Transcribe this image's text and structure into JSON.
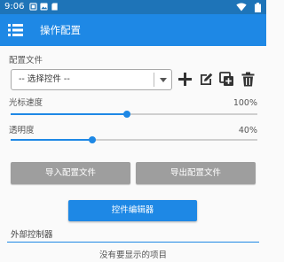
{
  "status_bar": {
    "time": "9:06",
    "icons": [
      "notification-icon",
      "image-icon",
      "sd-card-icon",
      "wifi-icon",
      "battery-icon"
    ]
  },
  "app_bar": {
    "title": "操作配置",
    "menu_icon": "menu-icon"
  },
  "config": {
    "label": "配置文件",
    "select_value": "-- 选择控件 --",
    "actions": [
      "add-icon",
      "edit-icon",
      "copy-icon",
      "delete-icon"
    ]
  },
  "cursor_speed": {
    "label": "光标速度",
    "value_text": "100%",
    "level": 0.47
  },
  "opacity": {
    "label": "透明度",
    "value_text": "40%",
    "level": 0.33
  },
  "buttons": {
    "import": "导入配置文件",
    "export": "导出配置文件",
    "editor": "控件编辑器"
  },
  "external": {
    "title": "外部控制器",
    "empty_text": "没有要显示的项目"
  },
  "colors": {
    "accent": "#1e88e5",
    "status_bar": "#1e74b8",
    "button_gray": "#9e9e9e"
  }
}
